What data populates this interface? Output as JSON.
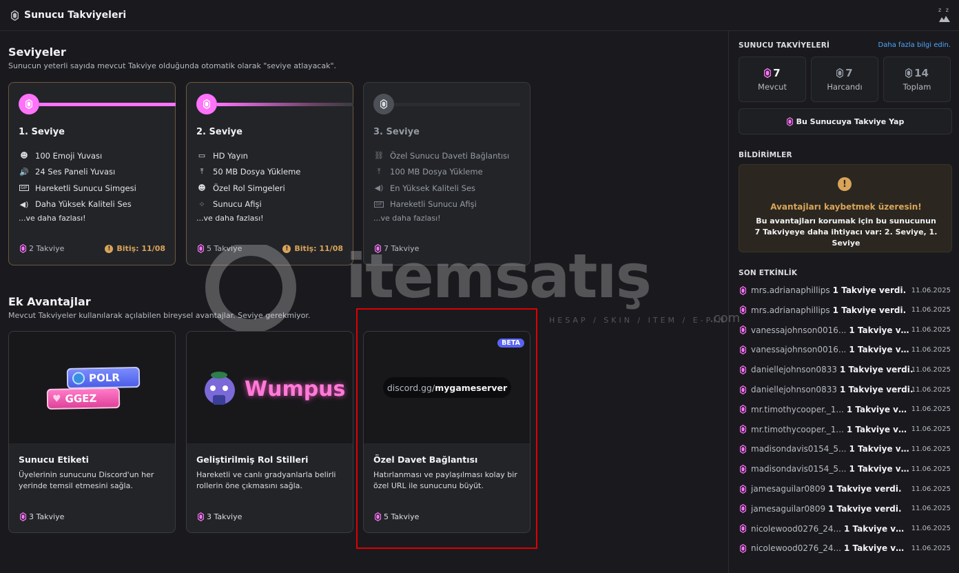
{
  "header": {
    "title": "Sunucu Takviyeleri",
    "sleep_badge": "z z"
  },
  "levels": {
    "title": "Seviyeler",
    "subtitle": "Sunucun yeterli sayıda mevcut Takviye olduğunda otomatik olarak \"seviye atlayacak\".",
    "tiers": [
      {
        "name": "1. Seviye",
        "perks": [
          "100 Emoji Yuvası",
          "24 Ses Paneli Yuvası",
          "Hareketli Sunucu Simgesi",
          "Daha Yüksek Kaliteli Ses"
        ],
        "more": "...ve daha fazlası!",
        "boosts": "2 Takviye",
        "expiry": "Bitiş: 11/08"
      },
      {
        "name": "2. Seviye",
        "perks": [
          "HD Yayın",
          "50 MB Dosya Yükleme",
          "Özel Rol Simgeleri",
          "Sunucu Afişi"
        ],
        "more": "...ve daha fazlası!",
        "boosts": "5 Takviye",
        "expiry": "Bitiş: 11/08"
      },
      {
        "name": "3. Seviye",
        "perks": [
          "Özel Sunucu Daveti Bağlantısı",
          "100 MB Dosya Yükleme",
          "En Yüksek Kaliteli Ses",
          "Hareketli Sunucu Afişi"
        ],
        "more": "...ve daha fazlası!",
        "boosts": "7 Takviye"
      }
    ]
  },
  "extras": {
    "title": "Ek Avantajlar",
    "subtitle": "Mevcut Takviyeler kullanılarak açılabilen bireysel avantajlar. Seviye gerekmiyor.",
    "perks": [
      {
        "title": "Sunucu Etiketi",
        "desc": "Üyelerinin sunucunu Discord'un her yerinde temsil etmesini sağla.",
        "boosts": "3 Takviye",
        "tag_top": "POLR",
        "tag_bottom": "GGEZ"
      },
      {
        "title": "Geliştirilmiş Rol Stilleri",
        "desc": "Hareketli ve canlı gradyanlarla belirli rollerin öne çıkmasını sağla.",
        "boosts": "3 Takviye",
        "wumpus": "Wumpus"
      },
      {
        "title": "Özel Davet Bağlantısı",
        "desc": "Hatırlanması ve paylaşılması kolay bir özel URL ile sunucunu büyüt.",
        "boosts": "5 Takviye",
        "beta": "BETA",
        "url_prefix": "discord.gg/",
        "url_slug": "mygameserver"
      }
    ]
  },
  "watermark": {
    "brand": "itemsatış",
    "tagline": "HESAP / SKIN / ITEM / E-PIN",
    "suffix": ".com"
  },
  "sidebar": {
    "boosts_heading": "SUNUCU TAKVİYELERİ",
    "learn_more": "Daha fazla bilgi edin.",
    "stats": [
      {
        "num": "7",
        "label": "Mevcut"
      },
      {
        "num": "7",
        "label": "Harcandı"
      },
      {
        "num": "14",
        "label": "Toplam"
      }
    ],
    "boost_button": "Bu Sunucuya Takviye Yap",
    "notifications_heading": "BİLDİRİMLER",
    "notice_title": "Avantajları kaybetmek üzeresin!",
    "notice_body": "Bu avantajları korumak için bu sunucunun 7 Takviyeye daha ihtiyacı var: 2. Seviye, 1. Seviye",
    "activity_heading": "SON ETKİNLİK",
    "activity": [
      {
        "user": "mrs.adrianaphillips",
        "text": "1 Takviye verdi.",
        "date": "11.06.2025"
      },
      {
        "user": "mrs.adrianaphillips",
        "text": "1 Takviye verdi.",
        "date": "11.06.2025"
      },
      {
        "user": "vanessajohnson0016...",
        "text": "1 Takviye ver...",
        "date": "11.06.2025"
      },
      {
        "user": "vanessajohnson0016...",
        "text": "1 Takviye ver...",
        "date": "11.06.2025"
      },
      {
        "user": "daniellejohnson0833",
        "text": "1 Takviye verdi.",
        "date": "11.06.2025"
      },
      {
        "user": "daniellejohnson0833",
        "text": "1 Takviye verdi.",
        "date": "11.06.2025"
      },
      {
        "user": "mr.timothycooper._1...",
        "text": "1 Takviye ver...",
        "date": "11.06.2025"
      },
      {
        "user": "mr.timothycooper._1...",
        "text": "1 Takviye ver...",
        "date": "11.06.2025"
      },
      {
        "user": "madisondavis0154_5...",
        "text": "1 Takviye ver...",
        "date": "11.06.2025"
      },
      {
        "user": "madisondavis0154_5...",
        "text": "1 Takviye ver...",
        "date": "11.06.2025"
      },
      {
        "user": "jamesaguilar0809",
        "text": "1 Takviye verdi.",
        "date": "11.06.2025"
      },
      {
        "user": "jamesaguilar0809",
        "text": "1 Takviye verdi.",
        "date": "11.06.2025"
      },
      {
        "user": "nicolewood0276_24...",
        "text": "1 Takviye ver...",
        "date": "11.06.2025"
      },
      {
        "user": "nicolewood0276_24...",
        "text": "1 Takviye ver...",
        "date": "11.06.2025"
      }
    ]
  },
  "colors": {
    "boost_pink": "#ff73fa",
    "gold": "#d9a459",
    "link": "#4ea8ff",
    "beta": "#5865f2"
  }
}
